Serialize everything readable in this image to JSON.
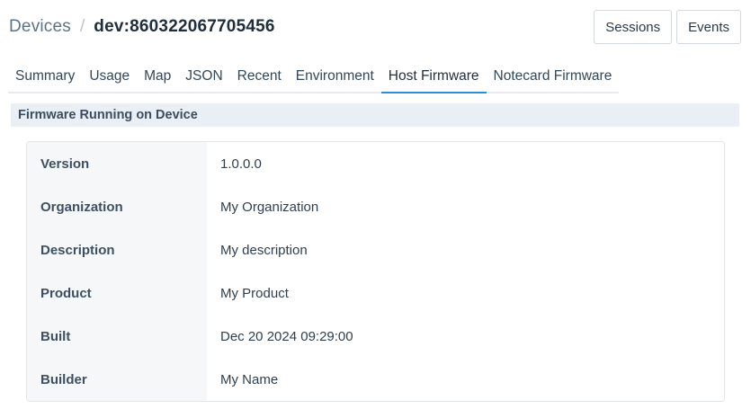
{
  "header": {
    "breadcrumb_root": "Devices",
    "separator": "/",
    "device_id": "dev:860322067705456"
  },
  "actions": {
    "sessions_label": "Sessions",
    "events_label": "Events"
  },
  "tabs": [
    {
      "label": "Summary"
    },
    {
      "label": "Usage"
    },
    {
      "label": "Map"
    },
    {
      "label": "JSON"
    },
    {
      "label": "Recent"
    },
    {
      "label": "Environment"
    },
    {
      "label": "Host Firmware",
      "active": true
    },
    {
      "label": "Notecard Firmware"
    }
  ],
  "section": {
    "title": "Firmware Running on Device"
  },
  "firmware": {
    "rows": [
      {
        "label": "Version",
        "value": "1.0.0.0"
      },
      {
        "label": "Organization",
        "value": "My Organization"
      },
      {
        "label": "Description",
        "value": "My description"
      },
      {
        "label": "Product",
        "value": "My Product"
      },
      {
        "label": "Built",
        "value": "Dec 20 2024 09:29:00"
      },
      {
        "label": "Builder",
        "value": "My Name"
      }
    ]
  },
  "colors": {
    "accent": "#2a8fd6",
    "section_bg": "#e9eff4"
  }
}
